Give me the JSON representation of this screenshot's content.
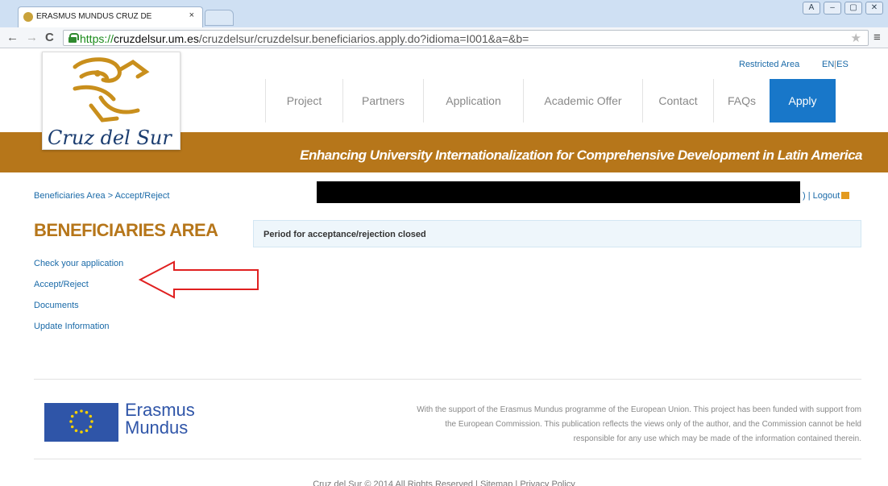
{
  "browser": {
    "tab_title": "ERASMUS MUNDUS CRUZ DE",
    "tab_close": "×",
    "url_scheme": "https://",
    "url_host": "cruzdelsur.um.es",
    "url_path": "/cruzdelsur/cruzdelsur.beneficiarios.apply.do?idioma=I001&a=&b=",
    "back": "←",
    "forward": "→",
    "reload": "C",
    "star": "★",
    "menu": "≡",
    "win_buttons": [
      "A",
      "–",
      "▢",
      "✕"
    ]
  },
  "header": {
    "restricted": "Restricted Area",
    "lang_en": "EN",
    "lang_sep": "|",
    "lang_es": "ES",
    "logo_text": "Cruz del Sur",
    "nav": [
      "Project",
      "Partners",
      "Application",
      "Academic Offer",
      "Contact",
      "FAQs"
    ],
    "apply": "Apply",
    "tagline": "Enhancing University Internationalization for Comprehensive Development in Latin America",
    "band_color": "#b6761a",
    "apply_color": "#1877c9"
  },
  "content": {
    "breadcrumb": "Beneficiaries Area > Accept/Reject",
    "user_tail": ") | ",
    "logout": "Logout",
    "section_title": "BENEFICIARIES AREA",
    "notice": "Period for acceptance/rejection closed",
    "menu": [
      "Check your application",
      "Accept/Reject",
      "Documents",
      "Update Information"
    ]
  },
  "footer": {
    "erasmus_line1": "Erasmus",
    "erasmus_line2": "Mundus",
    "legal_lines": [
      "With the support of the Erasmus Mundus programme of the European Union. This project has been funded with support from",
      "the European Commission. This publication reflects the views only of the author, and the Commission cannot be held",
      "responsible for any use which may be made of the information contained therein."
    ],
    "copyright": "Cruz del Sur © 2014 All Rights Reserved   |   Sitemap   |   Privacy Policy"
  }
}
